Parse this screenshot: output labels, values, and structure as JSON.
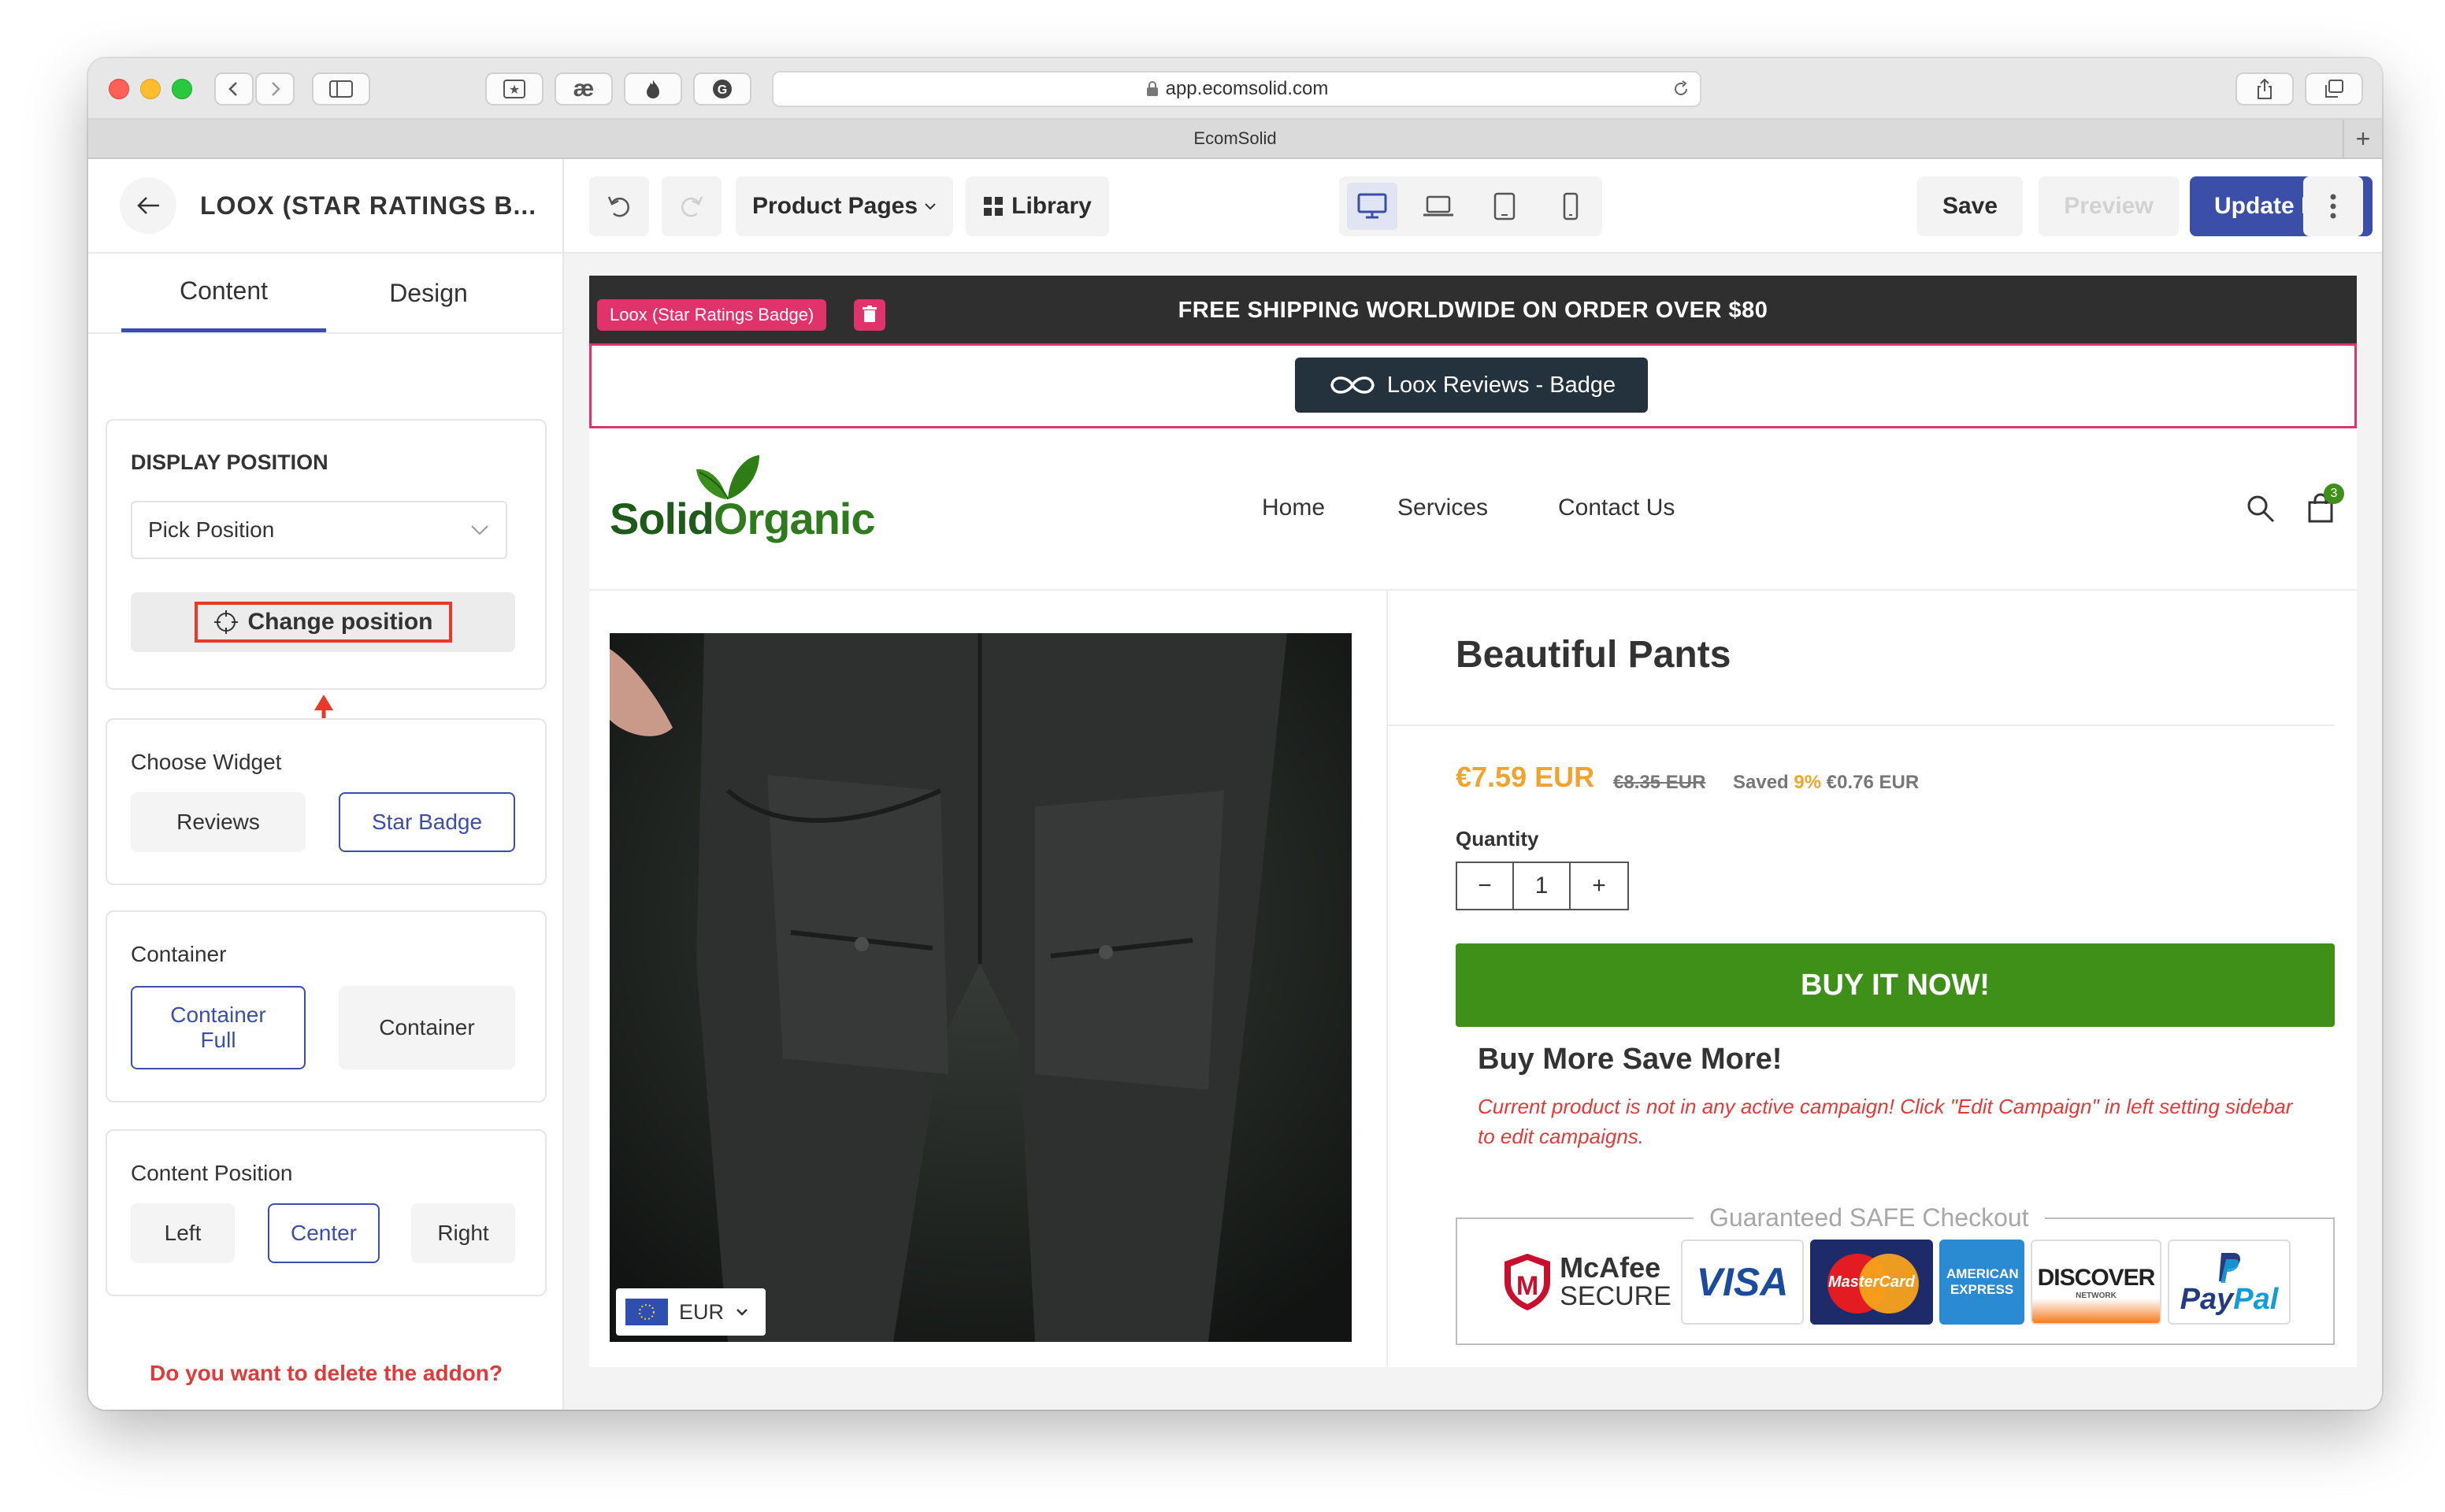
{
  "browser": {
    "url": "app.ecomsolid.com",
    "tab_title": "EcomSolid",
    "ext_icon_2": "æ"
  },
  "sidebar": {
    "title": "LOOX (STAR RATINGS B...",
    "tabs": [
      "Content",
      "Design"
    ],
    "display_position": {
      "label": "DISPLAY POSITION",
      "select_value": "Pick Position",
      "change_button": "Change position"
    },
    "choose_widget": {
      "label": "Choose Widget",
      "options": [
        "Reviews",
        "Star Badge"
      ]
    },
    "container": {
      "label": "Container",
      "options": [
        "Container Full",
        "Container"
      ]
    },
    "content_position": {
      "label": "Content Position",
      "options": [
        "Left",
        "Center",
        "Right"
      ]
    },
    "delete_prompt": "Do you want to delete the addon?"
  },
  "toolbar": {
    "product_pages": "Product Pages",
    "library": "Library",
    "save": "Save",
    "preview": "Preview",
    "update_live": "Update Live"
  },
  "store": {
    "announcement": "FREE SHIPPING WORLDWIDE ON ORDER OVER $80",
    "loox_tag": "Loox (Star Ratings Badge)",
    "loox_badge": "Loox Reviews - Badge",
    "logo_solid": "Solid",
    "logo_organic": "Organic",
    "nav": [
      "Home",
      "Services",
      "Contact Us"
    ],
    "cart_count": "3",
    "currency": "EUR",
    "product": {
      "name": "Beautiful Pants",
      "price": "€7.59 EUR",
      "old_price": "€8.35 EUR",
      "saved_label": "Saved",
      "saved_percent": "9%",
      "saved_amount": "€0.76 EUR",
      "quantity_label": "Quantity",
      "quantity": "1",
      "buy_button": "BUY IT NOW!",
      "bmsm_title": "Buy More Save More!",
      "campaign_note": "Current product is not in any active campaign! Click \"Edit Campaign\" in left setting sidebar to edit campaigns."
    },
    "safe_checkout": {
      "title": "Guaranteed SAFE Checkout",
      "mcafee": "McAfee",
      "mcafee_sub": "SECURE",
      "visa": "VISA",
      "mastercard": "MasterCard",
      "amex": "AMERICAN EXPRESS",
      "discover": "DISCOVER",
      "discover_sub": "NETWORK",
      "paypal_pay": "Pay",
      "paypal_pal": "Pal"
    }
  },
  "colors": {
    "accent": "#3b4fa8",
    "loox_pink": "#e0336b",
    "buy_green": "#3f9019",
    "price_orange": "#f0a430",
    "annotation_red": "#e8392b"
  }
}
